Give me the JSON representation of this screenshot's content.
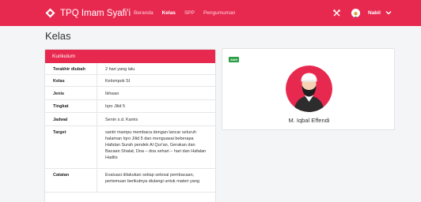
{
  "topbar": {
    "brand_name": "TPQ Imam Syafi'i",
    "nav": [
      {
        "label": "Beranda",
        "active": false
      },
      {
        "label": "Kelas",
        "active": true
      },
      {
        "label": "SPP",
        "active": false
      },
      {
        "label": "Pengumuman",
        "active": false
      }
    ],
    "tools_icon": "tools-icon",
    "user_name": "Nabil",
    "brand_color": "#e8294f"
  },
  "page": {
    "title": "Kelas"
  },
  "kurikulum": {
    "header": "Kurikulum",
    "rows": [
      {
        "label": "Terakhir diubah",
        "value": [
          "2 hari yang lalu"
        ]
      },
      {
        "label": "Kelas",
        "value": [
          "Kelompok SI"
        ]
      },
      {
        "label": "Jenis",
        "value": [
          "Ikhwan"
        ]
      },
      {
        "label": "Tingkat",
        "value": [
          "Iqro Jilid 5"
        ]
      },
      {
        "label": "Jadwal",
        "value": [
          "Senin s.d. Kamis"
        ]
      },
      {
        "label": "Target",
        "value": [
          "santri mampu membaca dengan lancar seluruh",
          "halaman Iqro Jilid 5 dan menguasai beberapa",
          "Hafalan Surah pendek Al Qur'an, Gerakan dan",
          "Bacaan Shalat, Doa – doa sehari – hari dan Hafalan",
          "Hadits"
        ]
      },
      {
        "label": "Catatan",
        "value": [
          "Evaluasi dilakukan setiap selesai pembacaan,",
          "pertemuan berikutnya diulangi untuk materi yang"
        ]
      }
    ]
  },
  "profile": {
    "status": "Aktif",
    "name": "M. Iqbal Effendi",
    "status_color": "#2a9d44"
  }
}
